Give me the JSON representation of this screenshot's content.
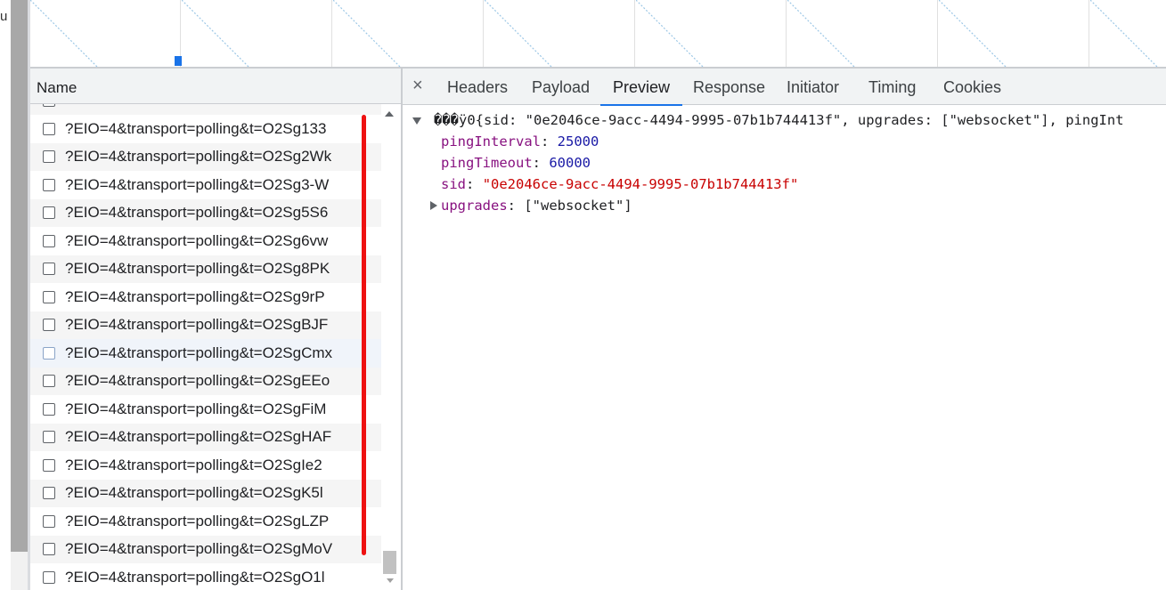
{
  "left_stub": "u",
  "name_header": "Name",
  "requests": [
    "?EIO=4&transport=polling&t=O2Sg133",
    "?EIO=4&transport=polling&t=O2Sg2Wk",
    "?EIO=4&transport=polling&t=O2Sg3-W",
    "?EIO=4&transport=polling&t=O2Sg5S6",
    "?EIO=4&transport=polling&t=O2Sg6vw",
    "?EIO=4&transport=polling&t=O2Sg8PK",
    "?EIO=4&transport=polling&t=O2Sg9rP",
    "?EIO=4&transport=polling&t=O2SgBJF",
    "?EIO=4&transport=polling&t=O2SgCmx",
    "?EIO=4&transport=polling&t=O2SgEEo",
    "?EIO=4&transport=polling&t=O2SgFiM",
    "?EIO=4&transport=polling&t=O2SgHAF",
    "?EIO=4&transport=polling&t=O2SgIe2",
    "?EIO=4&transport=polling&t=O2SgK5l",
    "?EIO=4&transport=polling&t=O2SgLZP",
    "?EIO=4&transport=polling&t=O2SgMoV",
    "?EIO=4&transport=polling&t=O2SgO1l"
  ],
  "tabs": {
    "close": "×",
    "headers": "Headers",
    "payload": "Payload",
    "preview": "Preview",
    "response": "Response",
    "initiator": "Initiator",
    "timing": "Timing",
    "cookies": "Cookies"
  },
  "preview": {
    "summary": "���ÿ0{sid: \"0e2046ce-9acc-4494-9995-07b1b744413f\", upgrades: [\"websocket\"], pingInt",
    "ping_interval_key": "pingInterval",
    "ping_interval_value": "25000",
    "ping_timeout_key": "pingTimeout",
    "ping_timeout_value": "60000",
    "sid_key": "sid",
    "sid_value": "\"0e2046ce-9acc-4494-9995-07b1b744413f\"",
    "upgrades_key": "upgrades",
    "upgrades_value": "[\"websocket\"]",
    "colon": ":"
  },
  "colors": {
    "accent": "#1a73e8",
    "annotation": "#ee1111",
    "key": "#881280",
    "number": "#1a1aa6",
    "string": "#c80000"
  }
}
